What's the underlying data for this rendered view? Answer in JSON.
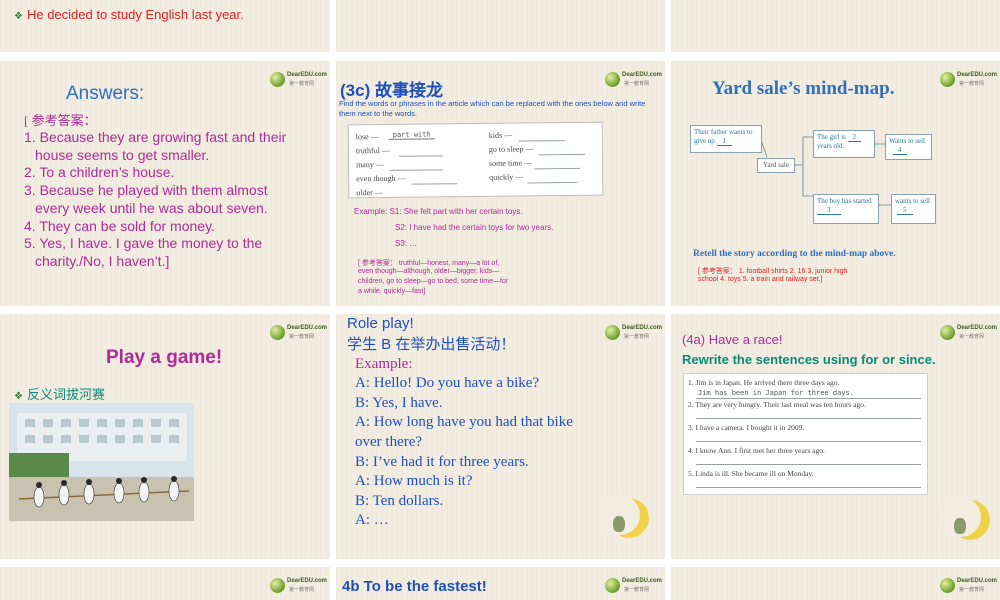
{
  "logo": {
    "name": "DearEDU.com",
    "sub": "第一教育网"
  },
  "slide1": {
    "text": "He decided to study English last year."
  },
  "slide4": {
    "title": "Answers:",
    "ref": "[ 参考答案：",
    "answers": [
      "1. Because they are growing fast and their",
      "house seems to get smaller.",
      "2. To a children’s house.",
      "3. Because he played with them almost",
      "every week until he was about seven.",
      "4. They can be sold for money.",
      "5. Yes, I have. I gave the money to the",
      "charity./No, I haven’t.]"
    ]
  },
  "slide5": {
    "title": "(3c)  故事接龙",
    "instruction": "Find the words or phrases in the article which can be replaced with the ones below and write them next to the words.",
    "left_items": [
      "lose —",
      "truthful —",
      "many —",
      "even though —",
      "older —"
    ],
    "left_answer": "part with",
    "right_items": [
      "kids —",
      "go to sleep —",
      "some time —",
      "quickly —"
    ],
    "example": "Example: S1: She felt part with her certain toys.",
    "s2": "S2: I have had the certain toys for two years.",
    "s3": "S3: …",
    "ref_lines": [
      "[ 参考答案：  truthful—honest, many—a lot of,",
      "even though—although, older—bigger, kids—",
      "children, go to sleep—go to bed, some time—for",
      "a while, quickly—fast]"
    ]
  },
  "slide6": {
    "title": "Yard sale’s mind-map.",
    "box_father": "Their  father  wants to give up",
    "blank1": "1",
    "center": "Yard sale",
    "box_girl": "The girl is",
    "girl_tail": "years old.",
    "blank2": "2",
    "box_sell4": "Wants to sell",
    "blank4": "4",
    "box_boy": "The boy has started",
    "blank3": "3",
    "box_sell5": "wants to sell",
    "blank5": "5",
    "retell": "Retell the story according to the mind-map above.",
    "ref_lines": [
      "[ 参考答案：  1. football shirts   2. 16   3. junior high",
      "school  4. toys   5. a train and railway set.]"
    ]
  },
  "slide7": {
    "title": "Play a game!",
    "bullet": "反义词拔河赛"
  },
  "slide8": {
    "title1": "Role play!",
    "title2": "学生 B 在举办出售活动！",
    "example": "Example:",
    "lines": [
      "A: Hello! Do you have a bike?",
      "B: Yes, I have.",
      "A: How long have you had that bike",
      "over there?",
      "B: I’ve had it for three years.",
      "A: How much is it?",
      "B: Ten dollars.",
      "A: …"
    ]
  },
  "slide9": {
    "title1": "(4a) Have a race!",
    "title2": "Rewrite the sentences using for or since.",
    "items": [
      "1.  Jim is in Japan. He arrived there three days ago.",
      "2.  They are very hungry. Their last meal was ten hours ago.",
      "3.  I have a camera. I bought it in 2009.",
      "4.  I know Ann. I first met her three years ago.",
      "5.  Linda is ill. She became ill on Monday."
    ],
    "handwritten": "Jim has been in Japan for three days."
  },
  "slide11": {
    "title": "4b To be the fastest!"
  },
  "colors": {
    "red": "#e02020",
    "blue": "#1f4fbf",
    "purple": "#b02a9a",
    "green": "#0a8a7a",
    "bg": "#f2ede0"
  }
}
